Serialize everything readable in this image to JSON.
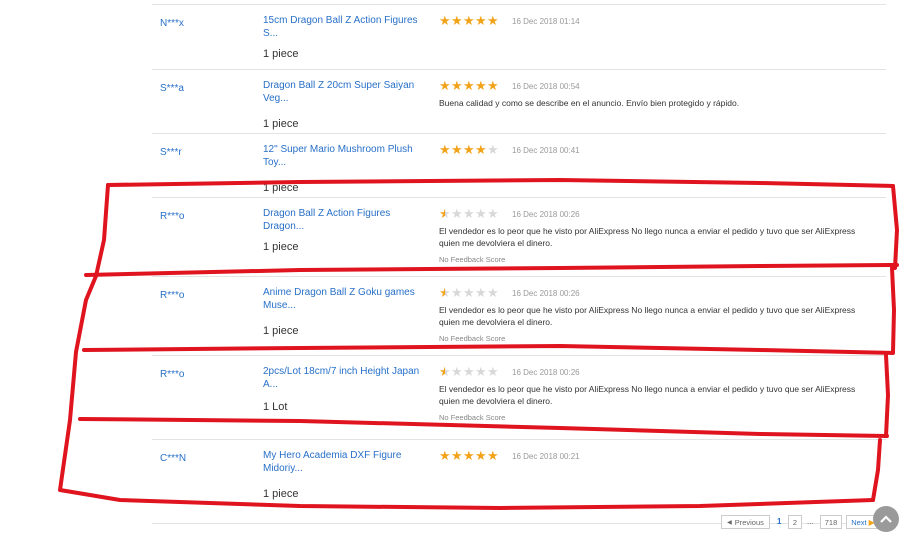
{
  "reviews": [
    {
      "buyer": "N***x",
      "product": "15cm Dragon Ball Z Action Figures S...",
      "quantity": "1 piece",
      "rating": 5,
      "date": "16 Dec 2018 01:14",
      "comment": "",
      "score": ""
    },
    {
      "buyer": "S***a",
      "product": "Dragon Ball Z 20cm Super Saiyan Veg...",
      "quantity": "1 piece",
      "rating": 5,
      "date": "16 Dec 2018 00:54",
      "comment": "Buena calidad y como se describe en el anuncio. Envío bien protegido y rápido.",
      "score": ""
    },
    {
      "buyer": "S***r",
      "product": "12\" Super Mario Mushroom Plush Toy...",
      "quantity": "1 piece",
      "rating": 4,
      "date": "16 Dec 2018 00:41",
      "comment": "",
      "score": ""
    },
    {
      "buyer": "R***o",
      "product": "Dragon Ball Z Action Figures Dragon...",
      "quantity": "1 piece",
      "rating": 1,
      "date": "16 Dec 2018 00:26",
      "comment": "El vendedor es lo peor que he visto por AliExpress No llego nunca a enviar el pedido y tuvo que ser AliExpress quien me devolviera el dinero.",
      "score": "No Feedback Score"
    },
    {
      "buyer": "R***o",
      "product": "Anime Dragon Ball Z Goku games Muse...",
      "quantity": "1 piece",
      "rating": 1,
      "date": "16 Dec 2018 00:26",
      "comment": "El vendedor es lo peor que he visto por AliExpress No llego nunca a enviar el pedido y tuvo que ser AliExpress quien me devolviera el dinero.",
      "score": "No Feedback Score"
    },
    {
      "buyer": "R***o",
      "product": "2pcs/Lot 18cm/7 inch Height Japan A...",
      "quantity": "1 Lot",
      "rating": 1,
      "date": "16 Dec 2018 00:26",
      "comment": "El vendedor es lo peor que he visto por AliExpress No llego nunca a enviar el pedido y tuvo que ser AliExpress quien me devolviera el dinero.",
      "score": "No Feedback Score"
    },
    {
      "buyer": "C***N",
      "product": "My Hero Academia DXF Figure Midoriy...",
      "quantity": "1 piece",
      "rating": 5,
      "date": "16 Dec 2018 00:21",
      "comment": "",
      "score": ""
    }
  ],
  "pagination": {
    "previous_label": "Previous",
    "current_page": "1",
    "page_2": "2",
    "ellipsis": "...",
    "last_page": "718",
    "next_label": "Next"
  },
  "colors": {
    "accent": "#2870c8",
    "star": "#f2a319",
    "annotation": "#e0141e"
  },
  "icons": {
    "back_to_top": "chevron-up-icon",
    "star": "star-icon"
  }
}
